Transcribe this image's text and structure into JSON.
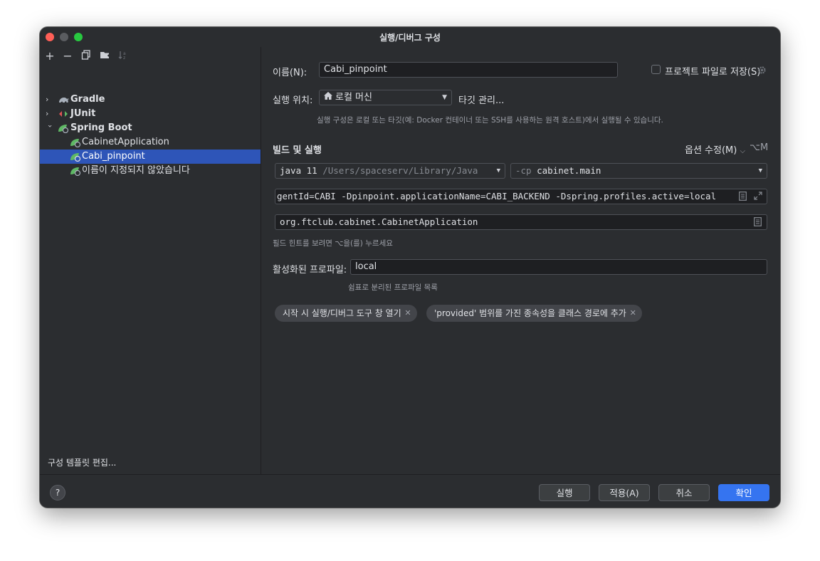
{
  "window": {
    "title": "실행/디버그 구성"
  },
  "toolbar": {
    "icons": [
      "add-icon",
      "remove-icon",
      "copy-icon",
      "folder-add-icon",
      "sort-icon"
    ]
  },
  "tree": {
    "items": [
      {
        "label": "Gradle"
      },
      {
        "label": "JUnit"
      },
      {
        "label": "Spring Boot"
      },
      {
        "label": "CabinetApplication"
      },
      {
        "label": "Cabi_pinpoint"
      },
      {
        "label": "이름이 지정되지 않았습니다"
      }
    ],
    "edit_templates": "구성 템플릿 편집..."
  },
  "form": {
    "name_label": "이름(N):",
    "name_value": "Cabi_pinpoint",
    "store_as_project_file": "프로젝트 파일로 저장(S)",
    "run_on_label": "실행 위치:",
    "run_on_value": "로컬 머신",
    "manage_targets": "타깃 관리...",
    "run_on_hint": "실행 구성은 로컬 또는 타깃(예: Docker 컨테이너 또는 SSH를 사용하는 원격 호스트)에서 실행될 수 있습니다.",
    "build_run_title": "빌드 및 실행",
    "modify_options": "옵션 수정(M)",
    "modify_options_shortcut": "⌥M",
    "jre_prefix": "java 11",
    "jre_path": "/Users/spaceserv/Library/Java",
    "classpath_prefix": "-cp",
    "classpath_module": "cabinet.main",
    "vm_options": "gentId=CABI -Dpinpoint.applicationName=CABI_BACKEND -Dspring.profiles.active=local",
    "main_class": "org.ftclub.cabinet.CabinetApplication",
    "field_hint": "필드 힌트를 보려면 ⌥을(를) 누르세요",
    "active_profiles_label": "활성화된 프로파일:",
    "active_profiles_value": "local",
    "active_profiles_hint": "쉼표로 분리된 프로파일 목록",
    "chips": [
      "시작 시 실행/디버그 도구 창 열기",
      "'provided' 범위를 가진 종속성을 클래스 경로에 추가"
    ]
  },
  "buttons": {
    "help": "?",
    "run": "실행",
    "apply": "적용(A)",
    "cancel": "취소",
    "ok": "확인"
  },
  "colors": {
    "selection": "#2e55b8",
    "link": "#548af7",
    "primary_button": "#3574f0"
  }
}
